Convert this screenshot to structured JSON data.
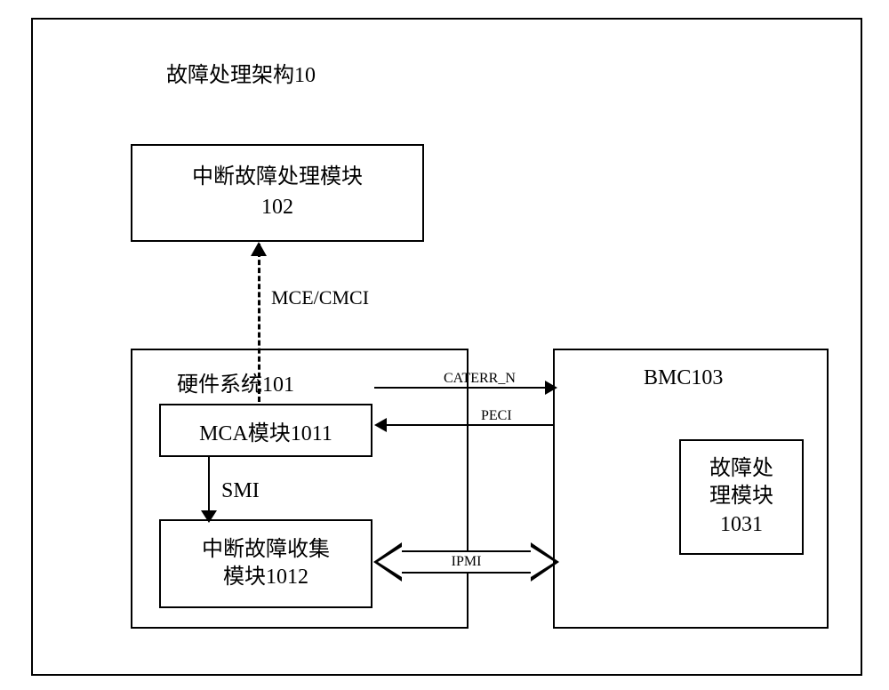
{
  "title": "故障处理架构10",
  "module_102": {
    "line1": "中断故障处理模块",
    "line2": "102"
  },
  "module_101": {
    "label": "硬件系统101",
    "module_1011": "MCA模块1011",
    "smi_label": "SMI",
    "module_1012": {
      "line1": "中断故障收集",
      "line2": "模块1012"
    }
  },
  "module_103": {
    "label": "BMC103",
    "module_1031": {
      "line1": "故障处",
      "line2": "理模块",
      "line3": "1031"
    }
  },
  "connections": {
    "mce_cmci": "MCE/CMCI",
    "caterr": "CATERR_N",
    "peci": "PECI",
    "ipmi": "IPMI"
  }
}
